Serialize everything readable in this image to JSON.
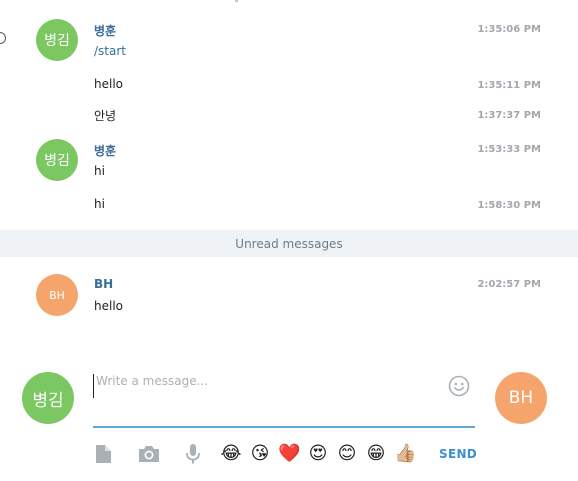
{
  "messages": [
    {
      "sender": "병훈",
      "avatar": "병김",
      "text": "/start",
      "time": "1:35:06 PM",
      "is_link": true
    },
    {
      "text": "hello",
      "time": "1:35:11 PM"
    },
    {
      "text": "안녕",
      "time": "1:37:37 PM"
    },
    {
      "sender": "병훈",
      "avatar": "병김",
      "text": "hi",
      "time": "1:53:33 PM"
    },
    {
      "text": "hi",
      "time": "1:58:30 PM"
    },
    {
      "sender": "BH",
      "avatar": "BH",
      "text": "hello",
      "time": "2:02:57 PM"
    }
  ],
  "unread_label": "Unread messages",
  "composer": {
    "placeholder": "Write a message...",
    "self_avatar": "병김",
    "peer_avatar": "BH",
    "send_label": "SEND"
  },
  "quick_emoji": [
    "😂",
    "😘",
    "❤️",
    "😍",
    "😊",
    "😁",
    "👍🏼"
  ],
  "colors": {
    "avatar_green": "#7bc862",
    "avatar_orange": "#f5a56c",
    "sender_name": "#3a6d99",
    "timestamp": "#a1a7ad",
    "send_button": "#3b8fd0",
    "input_underline": "#62a8d5",
    "unread_bar": "#f0f3f5"
  },
  "icons": [
    "file-icon",
    "camera-icon",
    "microphone-icon",
    "smiley-icon"
  ]
}
